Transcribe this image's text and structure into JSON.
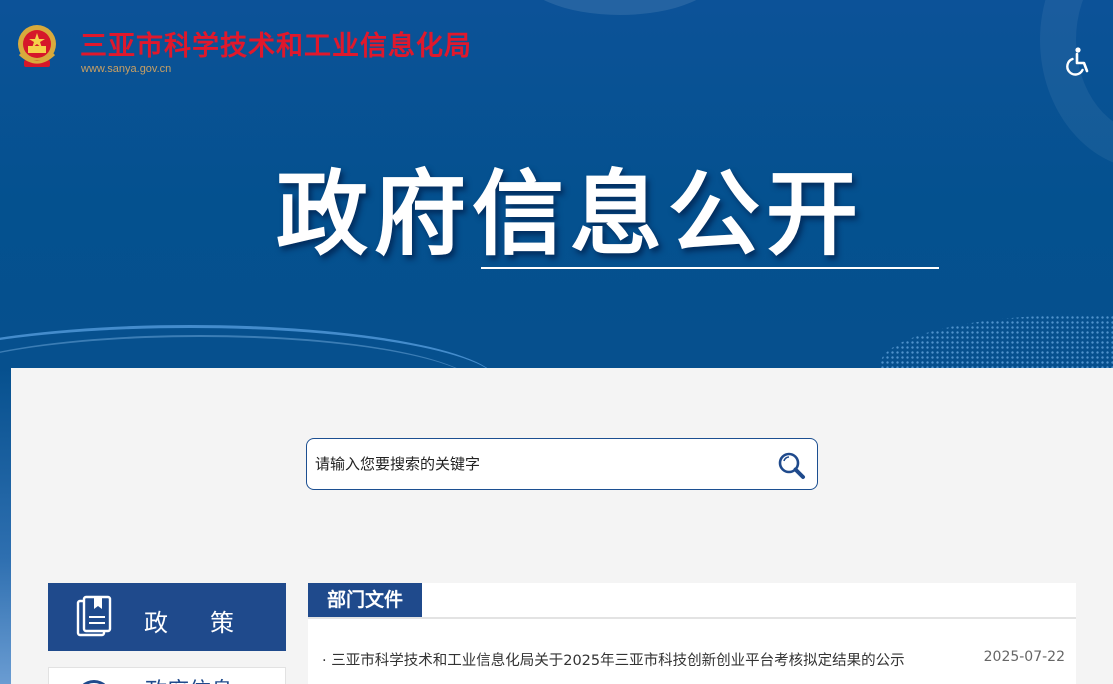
{
  "header": {
    "site_title": "三亚市科学技术和工业信息化局",
    "site_url": "www.sanya.gov.cn",
    "hero_title": "政府信息公开",
    "accessibility_icon": "wheelchair-icon",
    "emblem_icon": "national-emblem-icon"
  },
  "search": {
    "placeholder": "请输入您要搜索的关键字",
    "button_icon": "search-icon"
  },
  "sidebar": {
    "items": [
      {
        "label": "政策",
        "icon": "document-icon"
      },
      {
        "label": "政府信息",
        "icon": "circle-icon"
      }
    ]
  },
  "panel": {
    "tab_label": "部门文件",
    "documents": [
      {
        "title": "· 三亚市科学技术和工业信息化局关于2025年三亚市科技创新创业平台考核拟定结果的公示",
        "date": "2025-07-22"
      }
    ]
  },
  "colors": {
    "banner_blue": "#04518f",
    "nav_blue": "#1f4a8c",
    "title_red": "#e0182c",
    "url_gold": "#c9a063"
  }
}
